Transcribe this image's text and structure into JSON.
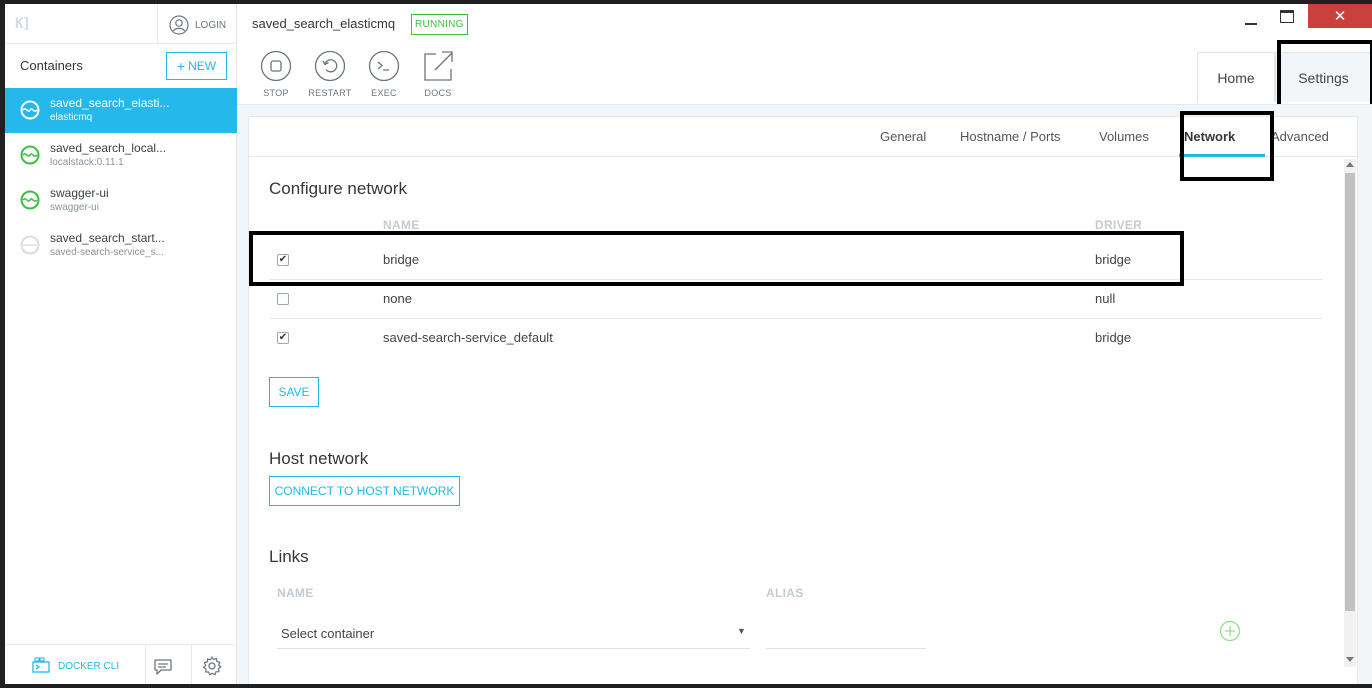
{
  "sidebar": {
    "login_label": "LOGIN",
    "containers_title": "Containers",
    "new_label": "NEW",
    "containers": [
      {
        "name": "saved_search_elasti...",
        "image": "elasticmq",
        "status": "running",
        "active": true
      },
      {
        "name": "saved_search_local...",
        "image": "localstack:0.11.1",
        "status": "running",
        "active": false
      },
      {
        "name": "swagger-ui",
        "image": "swagger-ui",
        "status": "running",
        "active": false
      },
      {
        "name": "saved_search_start...",
        "image": "saved-search-service_s...",
        "status": "stopped",
        "active": false
      }
    ],
    "docker_cli_label": "DOCKER CLI"
  },
  "header": {
    "container_title": "saved_search_elasticmq",
    "status_badge": "RUNNING",
    "actions": [
      {
        "label": "STOP",
        "icon": "stop-icon"
      },
      {
        "label": "RESTART",
        "icon": "restart-icon"
      },
      {
        "label": "EXEC",
        "icon": "terminal-icon"
      },
      {
        "label": "DOCS",
        "icon": "external-link-icon"
      }
    ],
    "tabs": {
      "home": "Home",
      "settings": "Settings"
    }
  },
  "settings": {
    "subtabs": [
      "General",
      "Hostname / Ports",
      "Volumes",
      "Network",
      "Advanced"
    ],
    "active_subtab": "Network"
  },
  "network": {
    "configure_title": "Configure network",
    "col_name": "NAME",
    "col_driver": "DRIVER",
    "rows": [
      {
        "name": "bridge",
        "driver": "bridge",
        "checked": true
      },
      {
        "name": "none",
        "driver": "null",
        "checked": false
      },
      {
        "name": "saved-search-service_default",
        "driver": "bridge",
        "checked": true
      }
    ],
    "save_label": "SAVE",
    "host_title": "Host network",
    "host_button": "CONNECT TO HOST NETWORK",
    "links_title": "Links",
    "links_col_name": "NAME",
    "links_col_alias": "ALIAS",
    "select_value": "Select container"
  },
  "colors": {
    "accent": "#24b8eb",
    "running": "#3ebf3e",
    "close": "#c9403d"
  }
}
